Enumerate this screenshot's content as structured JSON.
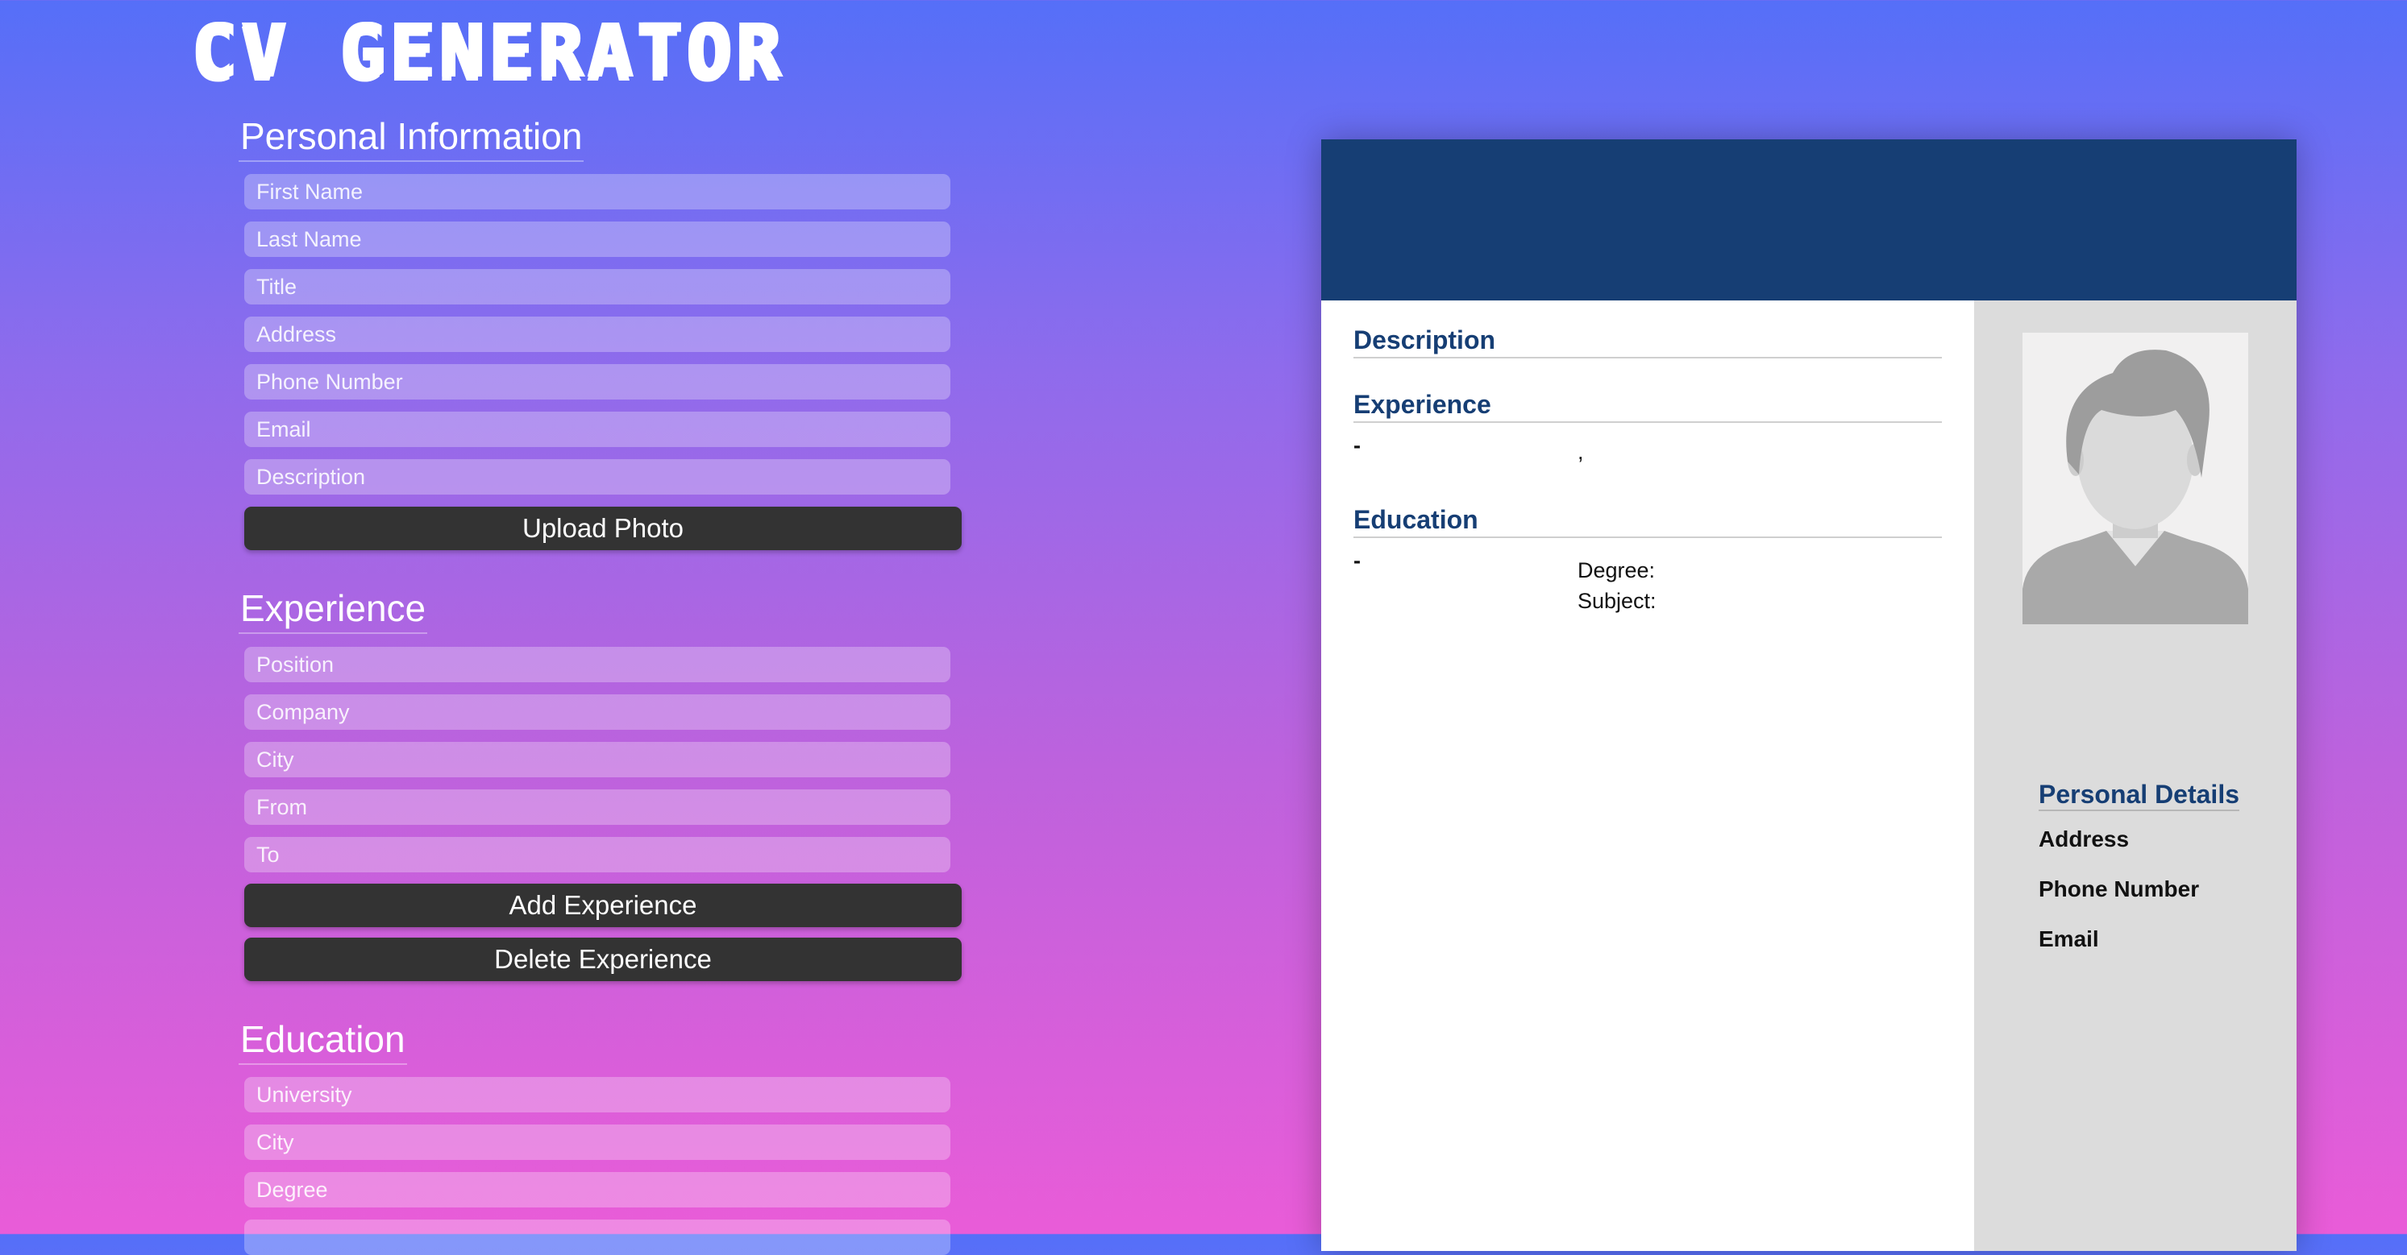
{
  "app_title": "CV GENERATOR",
  "personal_info": {
    "title": "Personal Information",
    "fields": {
      "first_name": "First Name",
      "last_name": "Last Name",
      "title": "Title",
      "address": "Address",
      "phone": "Phone Number",
      "email": "Email",
      "description": "Description"
    },
    "upload_label": "Upload Photo"
  },
  "experience": {
    "title": "Experience",
    "fields": {
      "position": "Position",
      "company": "Company",
      "city": "City",
      "from": "From",
      "to": "To"
    },
    "add_label": "Add Experience",
    "delete_label": "Delete Experience"
  },
  "education": {
    "title": "Education",
    "fields": {
      "university": "University",
      "city": "City",
      "degree": "Degree"
    }
  },
  "cv_preview": {
    "description_heading": "Description",
    "experience_heading": "Experience",
    "experience_dash": "-",
    "experience_comma": ",",
    "education_heading": "Education",
    "education_dash": "-",
    "degree_label": "Degree:",
    "subject_label": "Subject:",
    "personal_details_heading": "Personal Details",
    "address_label": "Address",
    "phone_label": "Phone Number",
    "email_label": "Email"
  },
  "colors": {
    "header": "#163e74",
    "heading_text": "#163e74",
    "button": "#333333",
    "sidebar": "#dcdcdc"
  },
  "icons": {
    "photo": "avatar-placeholder-icon"
  }
}
